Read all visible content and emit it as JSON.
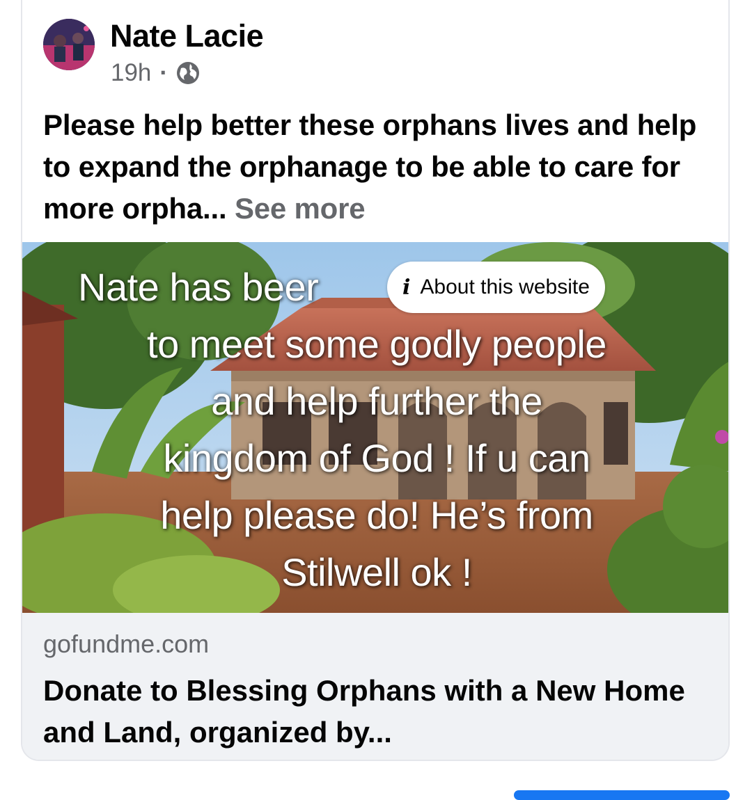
{
  "post": {
    "author": "Nate Lacie",
    "time": "19h",
    "separator": "·",
    "audience_icon": "globe-icon",
    "text": "Please help better these orphans lives and help to expand the orphanage to be able to care for more orpha...",
    "see_more": "See more"
  },
  "link_preview": {
    "overlay_text": "Nate has been blessed to meet some godly people and help further the kingdom of God ! If u can help please do! He’s from Stilwell ok !",
    "overlay_visible_lines": [
      "Nate has beer",
      "to meet some godly people",
      "and help further the",
      "kingdom of God ! If u can",
      "help please do! He’s from",
      "Stilwell ok !"
    ],
    "about_website_icon": "info-icon",
    "about_website_label": "About this website",
    "domain": "gofundme.com",
    "title": "Donate to Blessing Orphans with a New Home and Land, organized by..."
  },
  "colors": {
    "text_primary": "#050505",
    "text_secondary": "#65676b",
    "footer_bg": "#f0f2f5",
    "accent": "#1877f2"
  }
}
